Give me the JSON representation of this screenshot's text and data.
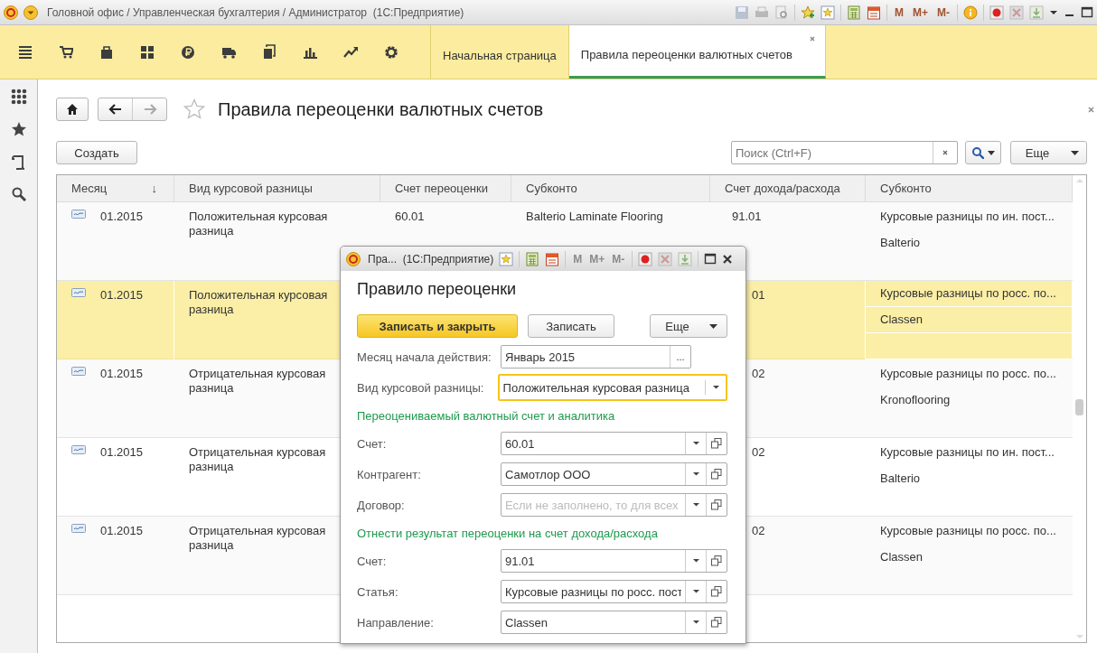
{
  "window": {
    "title": "Головной офис / Управленческая бухгалтерия / Администратор  (1С:Предприятие)",
    "memory_buttons": [
      {
        "label": "M",
        "disabled": false
      },
      {
        "label": "M+",
        "disabled": false
      },
      {
        "label": "M-",
        "disabled": false
      }
    ]
  },
  "tabs": [
    {
      "label": "Начальная страница",
      "selected": false
    },
    {
      "label": "Правила переоценки валютных счетов",
      "selected": true
    }
  ],
  "page": {
    "title": "Правила переоценки валютных счетов",
    "create_button": "Создать",
    "search": {
      "placeholder": "Поиск (Ctrl+F)"
    },
    "more_button": "Еще"
  },
  "table": {
    "columns": [
      {
        "label": "Месяц",
        "sort_mark": "↓"
      },
      {
        "label": "Вид курсовой разницы"
      },
      {
        "label": "Счет переоценки"
      },
      {
        "label": "Субконто"
      },
      {
        "label": "Счет дохода/расхода"
      },
      {
        "label": "Субконто"
      }
    ],
    "rows": [
      {
        "selected": false,
        "covered": false,
        "month": "01.2015",
        "kind": "Положительная курсовая разница",
        "account": "60.01",
        "subconto": "Balterio Laminate Flooring",
        "income_account": "91.01",
        "subconto_2": [
          "Курсовые разницы по ин. пост...",
          "Balterio"
        ]
      },
      {
        "selected": true,
        "covered": true,
        "month": "01.2015",
        "kind": "Положительная курсовая разница",
        "income_account": "01",
        "subconto_2": [
          "Курсовые разницы по росс. по...",
          "Classen"
        ]
      },
      {
        "selected": false,
        "covered": true,
        "month": "01.2015",
        "kind": "Отрицательная курсовая разница",
        "income_account": "02",
        "subconto_2": [
          "Курсовые разницы по росс. по...",
          "Kronoflooring"
        ]
      },
      {
        "selected": false,
        "covered": true,
        "month": "01.2015",
        "kind": "Отрицательная курсовая разница",
        "income_account": "02",
        "subconto_2": [
          "Курсовые разницы по ин. пост...",
          "Balterio"
        ]
      },
      {
        "selected": false,
        "covered": true,
        "month": "01.2015",
        "kind": "Отрицательная курсовая разница",
        "income_account": "02",
        "subconto_2": [
          "Курсовые разницы по росс. по...",
          "Classen"
        ]
      }
    ]
  },
  "dialog": {
    "title": "Пра...  (1С:Предприятие)",
    "memory_buttons": [
      {
        "label": "M",
        "disabled": true
      },
      {
        "label": "M+",
        "disabled": true
      },
      {
        "label": "M-",
        "disabled": true
      }
    ],
    "heading": "Правило переоценки",
    "buttons": [
      {
        "kind": "primary",
        "label": "Записать и закрыть"
      },
      {
        "kind": "plain",
        "label": "Записать"
      },
      {
        "kind": "menu",
        "label": "Еще"
      }
    ],
    "fields": [
      {
        "kind": "choice",
        "label": "Месяц начала действия:",
        "value": "Январь 2015",
        "button": "...",
        "focused": false
      },
      {
        "kind": "select",
        "label": "Вид курсовой разницы:",
        "value": "Положительная курсовая разница",
        "focused": true
      },
      {
        "kind": "section",
        "text": "Переоцениваемый валютный счет и аналитика"
      },
      {
        "kind": "link",
        "label": "Счет:",
        "value": "60.01",
        "focused": false
      },
      {
        "kind": "link",
        "label": "Контрагент:",
        "value": "Самотлор ООО",
        "focused": false
      },
      {
        "kind": "link",
        "label": "Договор:",
        "placeholder": "Если не заполнено, то для всех",
        "focused": false
      },
      {
        "kind": "section",
        "text": "Отнести результат переоценки на счет дохода/расхода"
      },
      {
        "kind": "link",
        "label": "Счет:",
        "value": "91.01",
        "focused": false
      },
      {
        "kind": "link",
        "label": "Статья:",
        "value": "Курсовые разницы по росс. пост",
        "focused": false
      },
      {
        "kind": "link",
        "label": "Направление:",
        "value": "Classen",
        "focused": false
      }
    ]
  }
}
